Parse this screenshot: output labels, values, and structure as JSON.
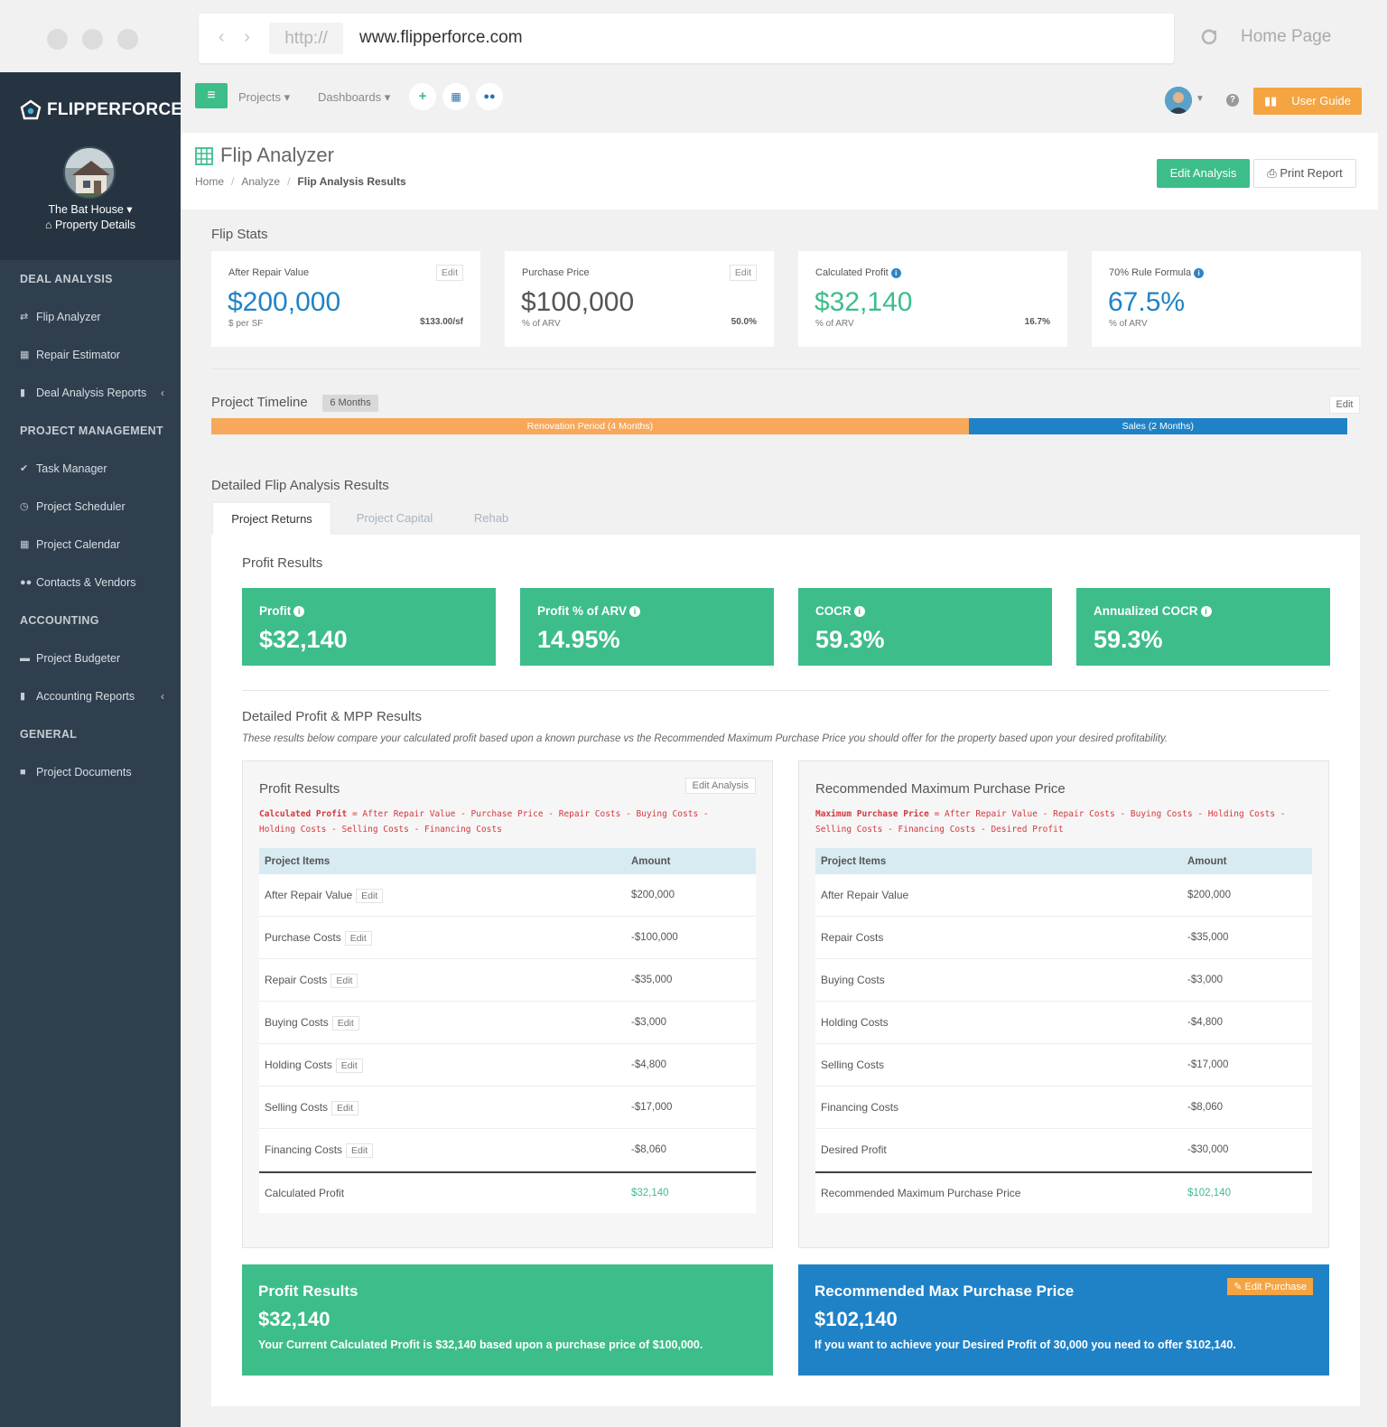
{
  "browser": {
    "nav_arrows": "‹ ›",
    "protocol": "http://",
    "url": "www.flipperforce.com",
    "home_page": "Home Page"
  },
  "sidebar": {
    "brand": "FLIPPERFORCE",
    "property_name": "The Bat House ▾",
    "property_details": "Property Details",
    "sections": [
      {
        "heading": "DEAL ANALYSIS",
        "items": [
          {
            "label": "Flip Analyzer",
            "icon": "exchange-icon"
          },
          {
            "label": "Repair Estimator",
            "icon": "calculator-icon"
          },
          {
            "label": "Deal Analysis Reports",
            "icon": "file-icon"
          }
        ]
      },
      {
        "heading": "PROJECT MANAGEMENT",
        "items": [
          {
            "label": "Task Manager",
            "icon": "check-circle-icon"
          },
          {
            "label": "Project Scheduler",
            "icon": "clock-icon"
          },
          {
            "label": "Project Calendar",
            "icon": "calendar-icon"
          },
          {
            "label": "Contacts & Vendors",
            "icon": "users-icon"
          }
        ]
      },
      {
        "heading": "ACCOUNTING",
        "items": [
          {
            "label": "Project Budgeter",
            "icon": "money-icon"
          },
          {
            "label": "Accounting Reports",
            "icon": "file-icon"
          }
        ]
      },
      {
        "heading": "GENERAL",
        "items": [
          {
            "label": "Project Documents",
            "icon": "folder-icon"
          }
        ]
      }
    ]
  },
  "topbar": {
    "projects": "Projects ▾",
    "dashboards": "Dashboards ▾",
    "user_guide": "User Guide"
  },
  "header": {
    "title": "Flip Analyzer",
    "breadcrumb": [
      "Home",
      "Analyze",
      "Flip Analysis Results"
    ],
    "edit_analysis": "Edit Analysis",
    "print_report": "Print Report"
  },
  "flip_stats": {
    "title": "Flip Stats",
    "cards": [
      {
        "label": "After Repair Value",
        "value": "$200,000",
        "sub": "$ per SF",
        "sub_right": "$133.00/sf",
        "edit": "Edit",
        "color": "#1f82c7"
      },
      {
        "label": "Purchase Price",
        "value": "$100,000",
        "sub": "% of ARV",
        "sub_right": "50.0%",
        "edit": "Edit",
        "color": "#555555"
      },
      {
        "label": "Calculated Profit",
        "value": "$32,140",
        "sub": "% of ARV",
        "sub_right": "16.7%",
        "color": "#3dbd8a"
      },
      {
        "label": "70% Rule Formula",
        "value": "67.5%",
        "sub": "% of ARV",
        "color": "#1f82c7"
      }
    ]
  },
  "timeline": {
    "title": "Project Timeline",
    "badge": "6 Months",
    "edit": "Edit",
    "renovation_label": "Renovation Period (4 Months)",
    "sales_label": "Sales (2 Months)",
    "renovation_months": 4,
    "sales_months": 2
  },
  "detailed": {
    "title": "Detailed Flip Analysis Results",
    "tabs": [
      "Project Returns",
      "Project Capital",
      "Rehab"
    ],
    "profit_results_title": "Profit Results",
    "metric_cards": [
      {
        "label": "Profit",
        "value": "$32,140"
      },
      {
        "label": "Profit % of ARV",
        "value": "14.95%"
      },
      {
        "label": "COCR",
        "value": "59.3%"
      },
      {
        "label": "Annualized COCR",
        "value": "59.3%"
      }
    ],
    "mpp_title": "Detailed Profit & MPP Results",
    "mpp_desc": "These results below compare your calculated profit based upon a known purchase vs the Recommended Maximum Purchase Price you should offer for the property based upon your desired profitability."
  },
  "profit_box": {
    "title": "Profit Results",
    "edit_analysis": "Edit Analysis",
    "formula_bold": "Calculated Profit",
    "formula_rest": " = After Repair Value - Purchase Price - Repair Costs - Buying Costs - Holding Costs - Selling Costs - Financing Costs",
    "col_items": "Project Items",
    "col_amount": "Amount",
    "rows": [
      {
        "item": "After Repair Value",
        "amount": "$200,000"
      },
      {
        "item": "Purchase Costs",
        "amount": "-$100,000"
      },
      {
        "item": "Repair Costs",
        "amount": "-$35,000"
      },
      {
        "item": "Buying Costs",
        "amount": "-$3,000"
      },
      {
        "item": "Holding Costs",
        "amount": "-$4,800"
      },
      {
        "item": "Selling Costs",
        "amount": "-$17,000"
      },
      {
        "item": "Financing Costs",
        "amount": "-$8,060"
      }
    ],
    "edit_label": "Edit",
    "total_label": "Calculated Profit",
    "total_value": "$32,140"
  },
  "mpp_box": {
    "title": "Recommended Maximum Purchase Price",
    "formula_bold": "Maximum Purchase Price",
    "formula_rest": " = After Repair Value - Repair Costs - Buying Costs - Holding Costs - Selling Costs - Financing Costs - Desired Profit",
    "col_items": "Project Items",
    "col_amount": "Amount",
    "rows": [
      {
        "item": "After Repair Value",
        "amount": "$200,000"
      },
      {
        "item": "Repair Costs",
        "amount": "-$35,000"
      },
      {
        "item": "Buying Costs",
        "amount": "-$3,000"
      },
      {
        "item": "Holding Costs",
        "amount": "-$4,800"
      },
      {
        "item": "Selling Costs",
        "amount": "-$17,000"
      },
      {
        "item": "Financing Costs",
        "amount": "-$8,060"
      },
      {
        "item": "Desired Profit",
        "amount": "-$30,000"
      }
    ],
    "total_label": "Recommended Maximum Purchase Price",
    "total_value": "$102,140"
  },
  "summary": {
    "profit_title": "Profit Results",
    "profit_value": "$32,140",
    "profit_text": "Your Current Calculated Profit is $32,140 based upon a purchase price of $100,000.",
    "mpp_title": "Recommended Max Purchase Price",
    "mpp_value": "$102,140",
    "mpp_text": "If you want to achieve your Desired Profit of 30,000 you need to offer $102,140.",
    "edit_purchase": "Edit Purchase"
  },
  "colors": {
    "green": "#3dbd8a",
    "blue": "#1f82c7",
    "orange": "#f5a442",
    "sidebar": "#2f3f4e"
  }
}
